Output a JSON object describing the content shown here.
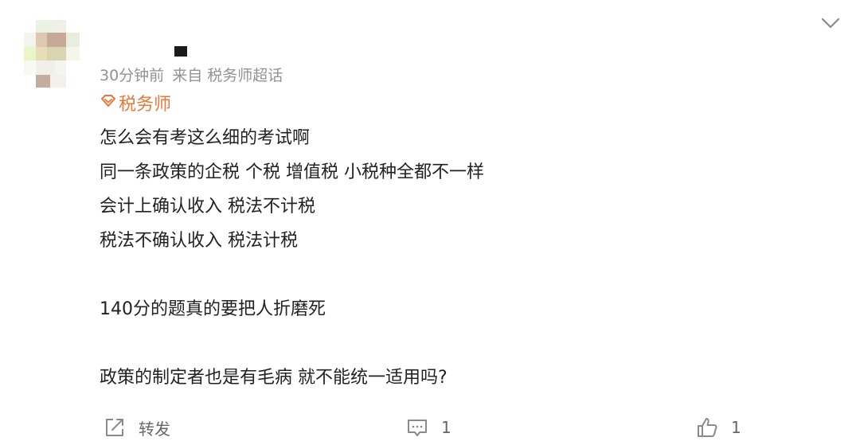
{
  "post": {
    "time": "30分钟前",
    "source": "来自 税务师超话",
    "badge_label": "税务师",
    "content_lines": [
      "怎么会有考这么细的考试啊",
      "同一条政策的企税 个税 增值税 小税种全都不一样",
      "会计上确认收入 税法不计税",
      "税法不确认收入 税法计税",
      "",
      "140分的题真的要把人折磨死",
      "",
      "政策的制定者也是有毛病 就不能统一适用吗?"
    ]
  },
  "actions": {
    "repost_label": "转发",
    "comment_count": "1",
    "like_count": "1"
  },
  "icons": {
    "menu": "chevron-down-icon",
    "badge": "supertopic-diamond-icon",
    "repost": "share-icon",
    "comment": "comment-icon",
    "like": "thumbs-up-icon"
  },
  "colors": {
    "badge": "#e8783a",
    "meta": "#939393",
    "text": "#222222"
  }
}
